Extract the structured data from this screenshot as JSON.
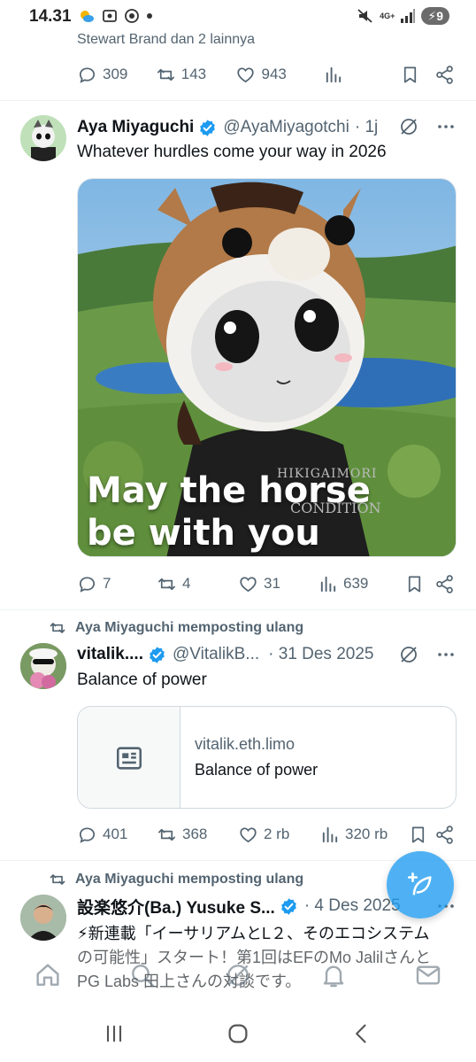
{
  "status_bar": {
    "time": "14.31",
    "network": "4G+",
    "battery": "9"
  },
  "previous_post": {
    "context": "Stewart Brand dan 2 lainnya",
    "replies": "309",
    "reposts": "143",
    "likes": "943"
  },
  "posts": [
    {
      "name": "Aya Miyaguchi",
      "handle": "@AyaMiyagotchi",
      "time": "· 1j",
      "text": "Whatever hurdles come your way in 2026",
      "media_caption_line1": "May the horse",
      "media_caption_line2": "be with you",
      "media_shirt_text": "HIKIGAIMORI",
      "media_shirt_text2": "CONDITION",
      "replies": "7",
      "reposts": "4",
      "likes": "31",
      "views": "639"
    },
    {
      "repost_label": "Aya Miyaguchi memposting ulang",
      "name": "vitalik....",
      "handle": "@VitalikB...",
      "time": "· 31 Des 2025",
      "text": "Balance of power",
      "link_domain": "vitalik.eth.limo",
      "link_title": "Balance of power",
      "replies": "401",
      "reposts": "368",
      "likes": "2 rb",
      "views": "320 rb"
    },
    {
      "repost_label": "Aya Miyaguchi memposting ulang",
      "name": "設楽悠介(Ba.) Yusuke S...",
      "handle": "",
      "time": "· 4 Des 2025",
      "text_line1": "⚡新連載「イーサリアムとL２、そのエコシステム",
      "text_line2": "の可能性」スタート！第1回はEFのMo Jalilさんと",
      "text_line3": "PG Labs 田上さんの対談です。"
    }
  ],
  "colors": {
    "accent": "#1d9bf0",
    "secondary_text": "#536471",
    "divider": "#eff3f4"
  },
  "icons": [
    "reply-icon",
    "repost-icon",
    "like-icon",
    "views-icon",
    "bookmark-icon",
    "share-icon",
    "grok-icon",
    "more-icon",
    "verified-icon",
    "compose-icon",
    "home-icon",
    "search-icon",
    "notifications-icon",
    "messages-icon"
  ]
}
